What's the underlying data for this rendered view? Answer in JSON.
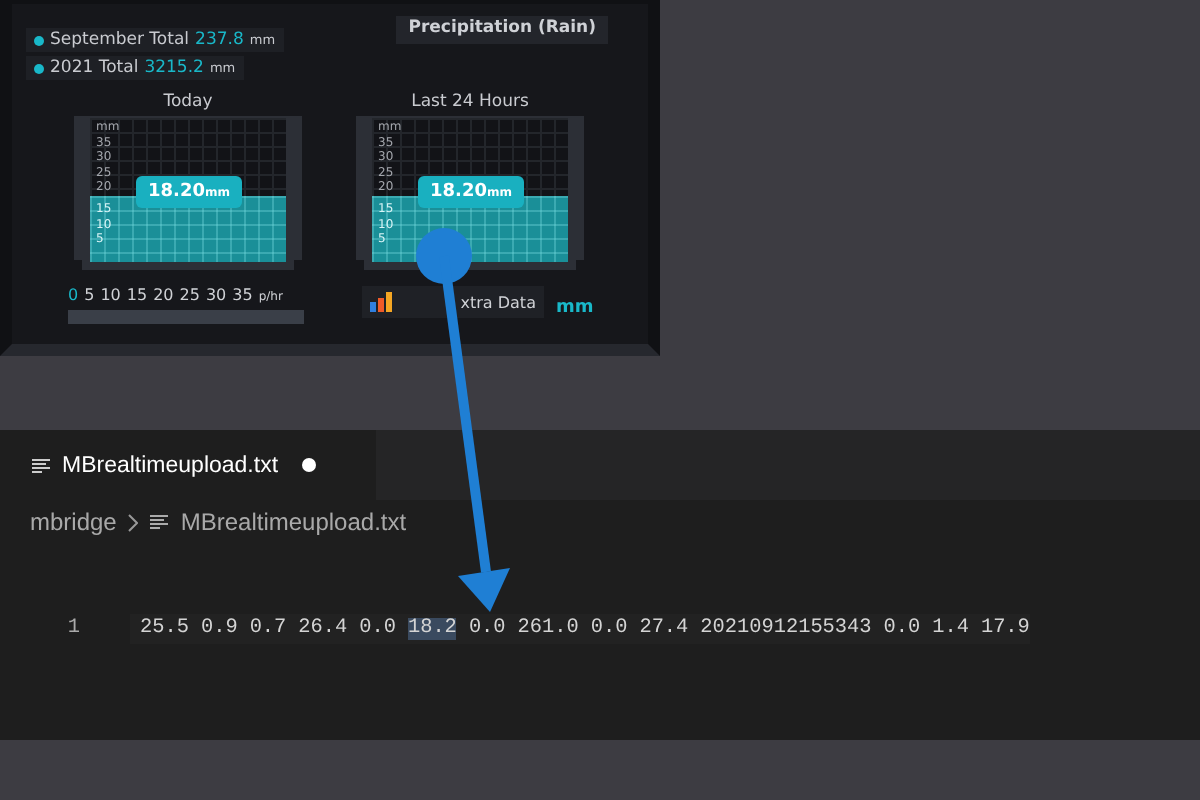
{
  "weather_panel": {
    "title": "Precipitation (Rain)",
    "totals": [
      {
        "label": "September Total",
        "value": "237.8",
        "unit": "mm",
        "color": "#19b8c9"
      },
      {
        "label": "2021 Total",
        "value": "3215.2",
        "unit": "mm",
        "color": "#19b8c9"
      }
    ],
    "gauges": [
      {
        "title": "Today",
        "scale": [
          "mm",
          "35",
          "30",
          "25",
          "20",
          "15",
          "10",
          "5"
        ],
        "value": "18.20",
        "unit": "mm"
      },
      {
        "title": "Last 24 Hours",
        "scale": [
          "mm",
          "35",
          "30",
          "25",
          "20",
          "15",
          "10",
          "5"
        ],
        "value": "18.20",
        "unit": "mm"
      }
    ],
    "rate_scale": {
      "current": "0",
      "ticks": [
        "5",
        "10",
        "15",
        "20",
        "25",
        "30",
        "35"
      ],
      "unit": "p/hr"
    },
    "extra_data_button": "xtra Data",
    "unit_toggle": "mm"
  },
  "editor": {
    "tabs": [
      {
        "label": "MBrealtimeupload.txt",
        "selected": true,
        "modified": true
      }
    ],
    "breadcrumb": [
      "mbridge",
      "MBrealtimeupload.txt"
    ],
    "lines": [
      {
        "number": "1",
        "tokens": [
          {
            "text": "25.5",
            "selected": false
          },
          {
            "text": "0.9",
            "selected": false
          },
          {
            "text": "0.7",
            "selected": false
          },
          {
            "text": "26.4",
            "selected": false
          },
          {
            "text": "0.0",
            "selected": false
          },
          {
            "text": "18.2",
            "selected": true
          },
          {
            "text": "0.0",
            "selected": false
          },
          {
            "text": "261.0",
            "selected": false
          },
          {
            "text": "0.0",
            "selected": false
          },
          {
            "text": "27.4",
            "selected": false
          },
          {
            "text": "20210912155343",
            "selected": false
          },
          {
            "text": "0.0",
            "selected": false
          },
          {
            "text": "1.4",
            "selected": false
          },
          {
            "text": "17.9",
            "selected": false
          }
        ]
      }
    ]
  }
}
